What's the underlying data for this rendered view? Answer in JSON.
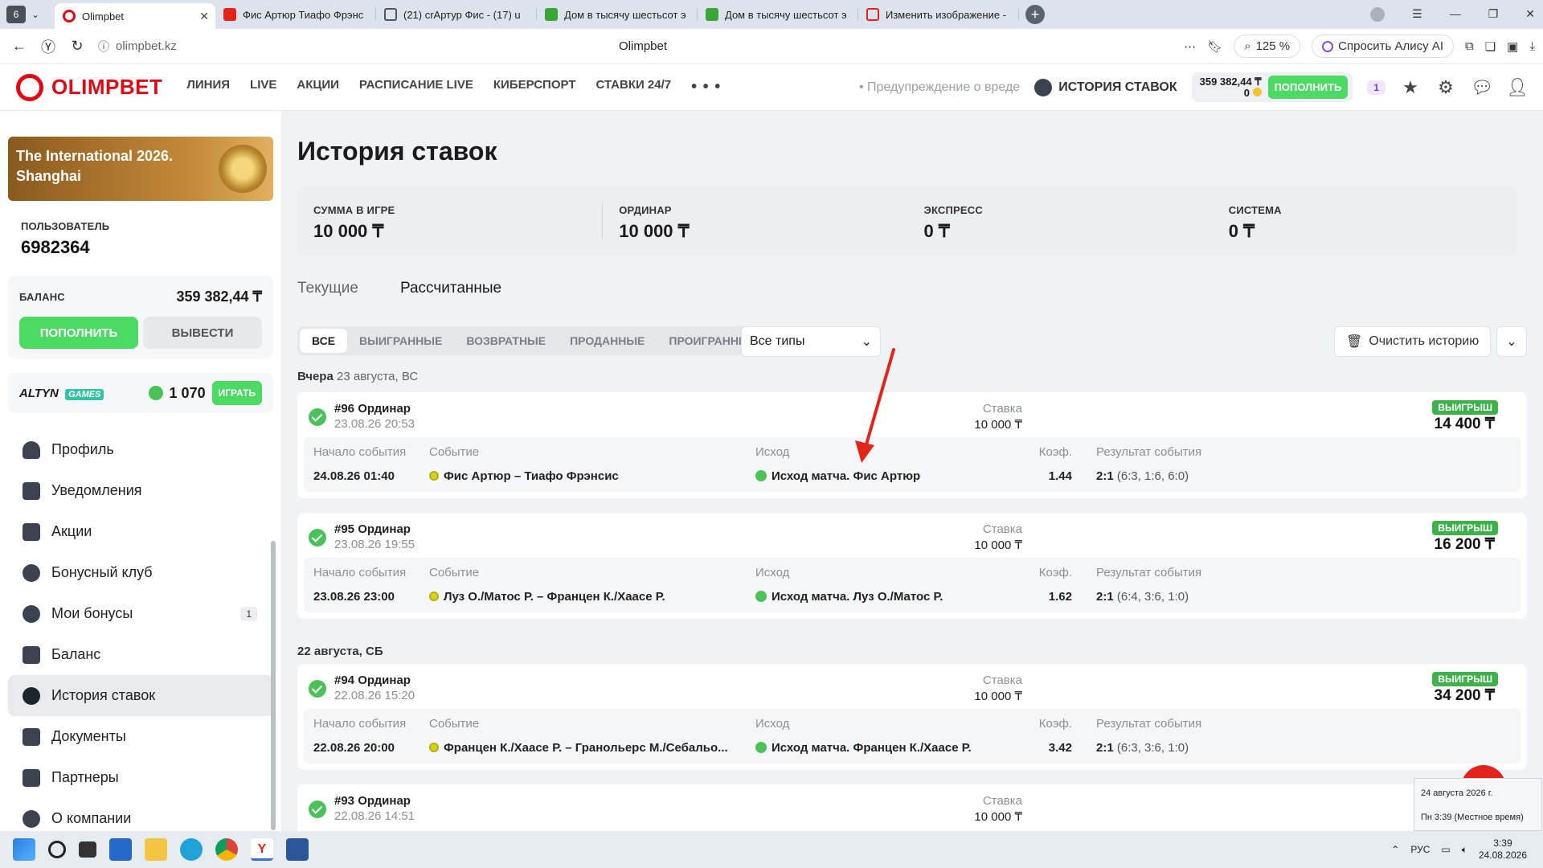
{
  "browser": {
    "tab_count": "6",
    "tabs": [
      {
        "title": "Olimpbet",
        "active": true
      },
      {
        "title": "Фис Артюр Тиафо Фрэнс"
      },
      {
        "title": "(21) сrАртур Фис - (17) u"
      },
      {
        "title": "Дом в тысячу шестьсот э"
      },
      {
        "title": "Дом в тысячу шестьсот э"
      },
      {
        "title": "Изменить изображение -"
      }
    ],
    "url": "olimpbet.kz",
    "page_title": "Olimpbet",
    "zoom": "125 %",
    "alice": "Спросить Алису AI"
  },
  "header": {
    "logo": "OLIMPBET",
    "nav": [
      "ЛИНИЯ",
      "LIVE",
      "АКЦИИ",
      "РАСПИСАНИЕ LIVE",
      "КИБЕРСПОРТ",
      "СТАВКИ 24/7"
    ],
    "more": "• • •",
    "warning": "• Предупреждение о вреде",
    "history_link": "ИСТОРИЯ СТАВОК",
    "balance": "359 382,44 ₸",
    "bonus": "0",
    "deposit": "ПОПОЛНИТЬ",
    "badge": "1"
  },
  "sidebar": {
    "promo": "The International 2026. Shanghai",
    "user_label": "ПОЛЬЗОВАТЕЛЬ",
    "user_id": "6982364",
    "balance_label": "БАЛАНС",
    "balance": "359 382,44 ₸",
    "deposit": "ПОПОЛНИТЬ",
    "withdraw": "ВЫВЕСТИ",
    "games_logo": "ALTYN",
    "games_tag": "GAMES",
    "games_coins": "1 070",
    "games_play": "ИГРАТЬ",
    "items": [
      {
        "label": "Профиль"
      },
      {
        "label": "Уведомления"
      },
      {
        "label": "Акции"
      },
      {
        "label": "Бонусный клуб"
      },
      {
        "label": "Мои бонусы",
        "badge": "1"
      },
      {
        "label": "Баланс"
      },
      {
        "label": "История ставок",
        "active": true
      },
      {
        "label": "Документы"
      },
      {
        "label": "Партнеры"
      },
      {
        "label": "О компании"
      }
    ]
  },
  "main": {
    "title": "История ставок",
    "summary": [
      {
        "label": "СУММА В ИГРЕ",
        "value": "10 000 ₸"
      },
      {
        "label": "ОРДИНАР",
        "value": "10 000 ₸"
      },
      {
        "label": "ЭКСПРЕСС",
        "value": "0 ₸"
      },
      {
        "label": "СИСТЕМА",
        "value": "0 ₸"
      }
    ],
    "tabs": [
      "Текущие",
      "Рассчитанные"
    ],
    "filters": [
      "ВСЕ",
      "ВЫИГРАННЫЕ",
      "ВОЗВРАТНЫЕ",
      "ПРОДАННЫЕ",
      "ПРОИГРАННЫЕ"
    ],
    "type_select": "Все типы",
    "clear_history": "Очистить историю",
    "columns": {
      "start": "Начало события",
      "event": "Событие",
      "outcome": "Исход",
      "coef": "Коэф.",
      "result": "Результат события"
    },
    "stake_label": "Ставка",
    "days": [
      {
        "title": "Вчера",
        "date": "23 августа, ВС"
      },
      {
        "title": "",
        "date": "22 августа, СБ"
      }
    ],
    "bets": [
      {
        "title": "#96 Ординар",
        "date": "23.08.26 20:53",
        "stake": "10 000 ₸",
        "status": "ВЫИГРЫШ",
        "win": "14 400 ₸",
        "start": "24.08.26 01:40",
        "event": "Фис Артюр – Тиафо Фрэнсис",
        "outcome": "Исход матча. Фис Артюр",
        "coef": "1.44",
        "result": "2:1",
        "score": "(6:3, 1:6, 6:0)"
      },
      {
        "title": "#95 Ординар",
        "date": "23.08.26 19:55",
        "stake": "10 000 ₸",
        "status": "ВЫИГРЫШ",
        "win": "16 200 ₸",
        "start": "23.08.26 23:00",
        "event": "Луз О./Матос Р. – Францен К./Хаасе Р.",
        "outcome": "Исход матча. Луз О./Матос Р.",
        "coef": "1.62",
        "result": "2:1",
        "score": "(6:4, 3:6, 1:0)"
      },
      {
        "title": "#94 Ординар",
        "date": "22.08.26 15:20",
        "stake": "10 000 ₸",
        "status": "ВЫИГРЫШ",
        "win": "34 200 ₸",
        "start": "22.08.26 20:00",
        "event": "Францен К./Хаасе Р. – Гранольерс М./Себальо...",
        "outcome": "Исход матча. Францен К./Хаасе Р.",
        "coef": "3.42",
        "result": "2:1",
        "score": "(6:3, 3:6, 1:0)"
      },
      {
        "title": "#93 Ординар",
        "date": "22.08.26 14:51",
        "stake": "10 000 ₸"
      }
    ]
  },
  "taskbar": {
    "lang": "РУС",
    "time": "3:39",
    "date": "24.08.2026",
    "popup_date": "24 августа 2026 г.",
    "popup_time": "Пн 3:39 (Местное время)"
  },
  "colors": {
    "brand": "#e30613",
    "accent_green": "#4cd964",
    "win_badge": "#3db24a",
    "arrow": "#e3241b"
  }
}
